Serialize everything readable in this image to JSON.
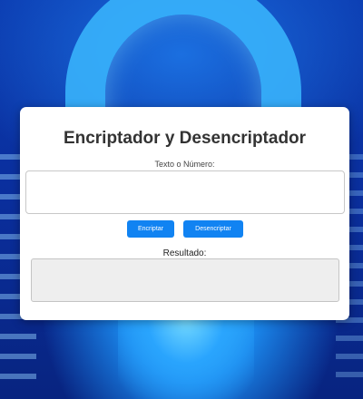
{
  "app": {
    "title": "Encriptador y Desencriptador"
  },
  "input": {
    "label": "Texto o Número:",
    "value": "",
    "placeholder": ""
  },
  "buttons": {
    "encrypt_label": "Encriptar",
    "decrypt_label": "Desencriptar"
  },
  "result": {
    "label": "Resultado:",
    "value": ""
  },
  "colors": {
    "accent": "#1183f2",
    "card_background": "#ffffff",
    "result_background": "#eeeeee",
    "page_background": "#0b2a8c"
  },
  "background": {
    "icon": "padlock-icon"
  }
}
